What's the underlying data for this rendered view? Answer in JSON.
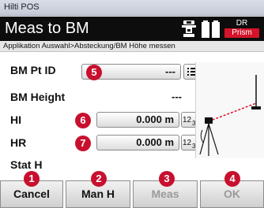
{
  "window": {
    "title": "Hilti POS"
  },
  "header": {
    "title": "Meas to BM",
    "mode_top": "DR",
    "mode_bottom": "Prism"
  },
  "breadcrumb": "Applikation Auswahl>Absteckung/BM Höhe messen",
  "rows": {
    "bm_pt_id": {
      "label": "BM Pt ID",
      "value": "---",
      "list_icon": "list-icon"
    },
    "bm_height": {
      "label": "BM Height",
      "value": "---"
    },
    "hi": {
      "label": "HI",
      "value": "0.000 m",
      "keypad_icon": "12 3"
    },
    "hr": {
      "label": "HR",
      "value": "0.000 m",
      "keypad_icon": "12 3"
    },
    "stat_h": {
      "label": "Stat H",
      "value": ""
    }
  },
  "badges": {
    "cancel": "1",
    "man_h": "2",
    "meas": "3",
    "ok": "4",
    "bm_pt_id": "5",
    "hi": "6",
    "hr": "7"
  },
  "softkeys": [
    {
      "label": "Cancel",
      "enabled": true
    },
    {
      "label": "Man H",
      "enabled": true
    },
    {
      "label": "Meas",
      "enabled": false
    },
    {
      "label": "OK",
      "enabled": false
    }
  ],
  "colors": {
    "badge": "#c8102e",
    "header_bg": "#0d0d0d",
    "prism": "#d4142a",
    "beam": "#d4142a"
  },
  "icons": [
    "level-bubble-icon",
    "battery-icon",
    "list-icon",
    "keypad-icon",
    "tripod-icon",
    "target-staff-icon"
  ]
}
